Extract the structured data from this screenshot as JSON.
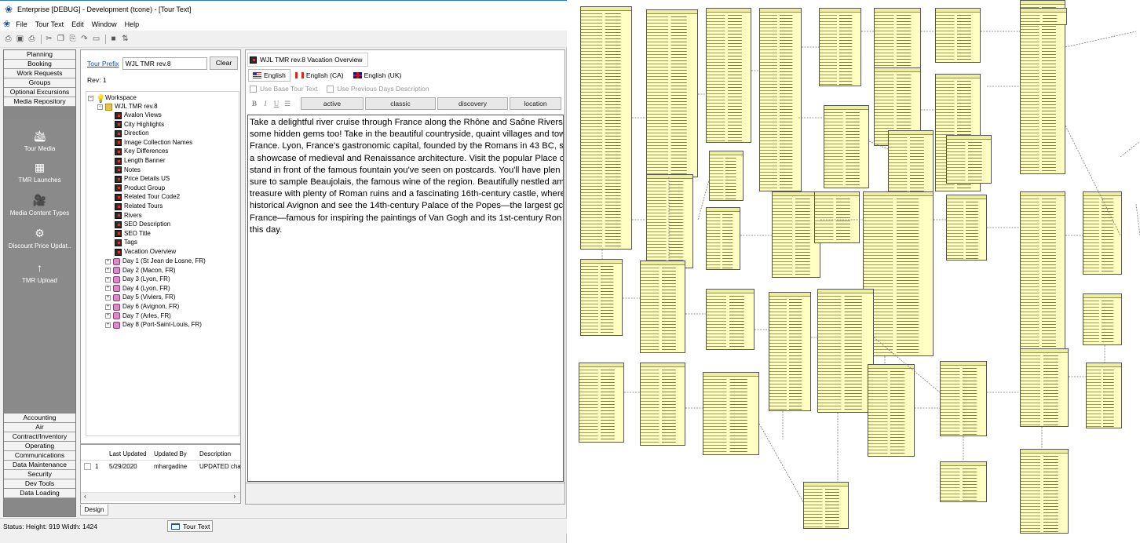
{
  "window": {
    "title": "Enterprise [DEBUG] - Development (tcone) - [Tour Text]"
  },
  "menu": {
    "items": [
      "File",
      "Tour Text",
      "Edit",
      "Window",
      "Help"
    ]
  },
  "toolbar": {
    "icons": [
      "printer-icon",
      "preview-icon",
      "print-icon",
      "cut-icon",
      "copy-icon",
      "paste-icon",
      "redo-icon",
      "screen-icon",
      "save-icon",
      "sort-icon"
    ]
  },
  "nav": {
    "top": [
      "Planning",
      "Booking",
      "Work Requests",
      "Groups",
      "Optional Excursions",
      "Media Repository"
    ],
    "tools": [
      "Tour Media",
      "TMR Launches",
      "Media Content Types",
      "Discount Price Updat..",
      "TMR Upload"
    ],
    "bottom": [
      "Accounting",
      "Air",
      "Contract/Inventory",
      "Operating",
      "Communications",
      "Data Maintenance",
      "Security",
      "Dev Tools",
      "Data Loading"
    ]
  },
  "prefix": {
    "link": "Tour Prefix",
    "value": "WJL TMR rev.8",
    "clear": "Clear",
    "rev": "Rev: 1"
  },
  "tree": {
    "workspace": "Workspace",
    "root": "WJL TMR rev.8",
    "items": [
      "Avalon Views",
      "City Highlights",
      "Direction",
      "Image Collection Names",
      "Key Differences",
      "Length Banner",
      "Notes",
      "Price Details US",
      "Product Group",
      "Related Tour Code2",
      "Related Tours",
      "Rivers",
      "SEO Description",
      "SEO Title",
      "Tags",
      "Vacation Overview"
    ],
    "days": [
      "Day 1 (St Jean de Losne, FR)",
      "Day 2 (Macon, FR)",
      "Day 3 (Lyon, FR)",
      "Day 4 (Lyon, FR)",
      "Day 5 (Viviers, FR)",
      "Day 6 (Avignon, FR)",
      "Day 7 (Arles, FR)",
      "Day 8 (Port-Saint-Louis, FR)"
    ]
  },
  "grid": {
    "headers": [
      "Last Updated",
      "Updated By",
      "Description"
    ],
    "row": {
      "index": "1",
      "last_updated": "5/29/2020",
      "updated_by": "mhargadine",
      "description": "UPDATED cha"
    },
    "tab": "Design"
  },
  "editor": {
    "doc_tab": "WJL TMR rev.8 Vacation Overview",
    "languages": [
      "English",
      "English (CA)",
      "English (UK)"
    ],
    "use_base": "Use Base Tour Text",
    "use_prev": "Use Previous Days Description",
    "styles": [
      "active",
      "classic",
      "discovery",
      "location"
    ],
    "lines": [
      "Take a delightful river cruise through France along the Rhône and Saône Rivers",
      "some hidden gems too! Take in the beautiful countryside, quaint villages and tow",
      "France. Lyon, France's gastronomic capital, founded by the Romans in 43 BC, s",
      "a showcase of medieval and Renaissance architecture. Visit the popular Place c",
      "stand in front of the famous fountain you've seen on postcards. You'll have plen",
      "sure to sample Beaujolais, the famous wine of the region. Beautifully nestled am",
      "treasure with plenty of Roman ruins and a fascinating 16th-century castle, where",
      "historical Avignon and see the 14th-century Palace of the Popes—the largest gc",
      "France—famous for inspiring the paintings of Van Gogh and its 1st-century Ron",
      "this day."
    ]
  },
  "status": {
    "text": "Status: Height: 919 Width: 1424",
    "task": "Tour Text"
  }
}
